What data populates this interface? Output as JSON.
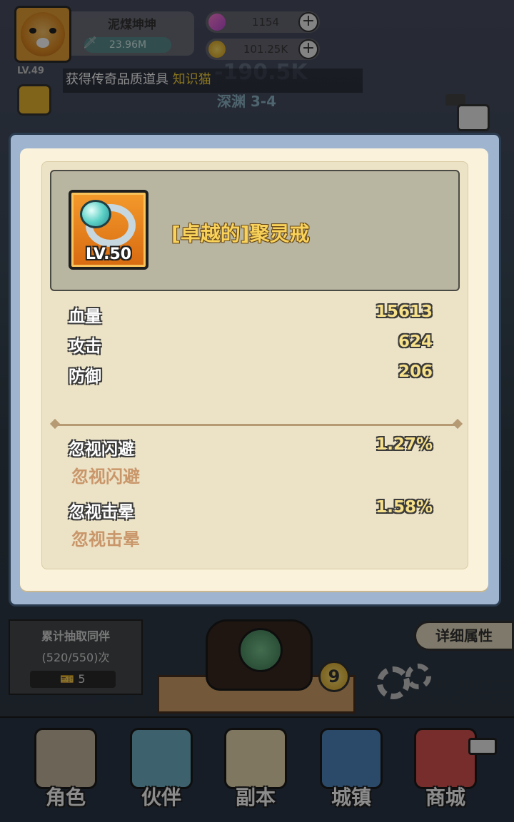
{
  "player": {
    "name": "泥煤坤坤",
    "power": "23.96M",
    "level": "LV.49"
  },
  "resources": {
    "gems": "1154",
    "coins": "101.25K"
  },
  "notice": {
    "prefix": "获得传奇品质道具",
    "highlight": "知识猫"
  },
  "scene": {
    "stage": "深渊 3-4",
    "damage": "-190.5K"
  },
  "item": {
    "level": "LV.50",
    "name": "[卓越的]聚灵戒"
  },
  "base_stats": [
    {
      "label": "血量",
      "value": "15613"
    },
    {
      "label": "攻击",
      "value": "624"
    },
    {
      "label": "防御",
      "value": "206"
    }
  ],
  "special_stats": [
    {
      "label": "忽视闪避",
      "value": "1.27%",
      "desc": "忽视闪避"
    },
    {
      "label": "忽视击晕",
      "value": "1.58%",
      "desc": "忽视击晕"
    }
  ],
  "gacha": {
    "title": "累计抽取同伴",
    "count": "(520/550)次",
    "tickets": "5",
    "coin_badge": "9"
  },
  "detail_button": "详细属性",
  "nav": [
    {
      "label": "角色",
      "color": "#c7b7a0"
    },
    {
      "label": "伙伴",
      "color": "#6fb3c7"
    },
    {
      "label": "副本",
      "color": "#e9d9b0"
    },
    {
      "label": "城镇",
      "color": "#4f87c2"
    },
    {
      "label": "商城",
      "color": "#d9534f"
    }
  ]
}
